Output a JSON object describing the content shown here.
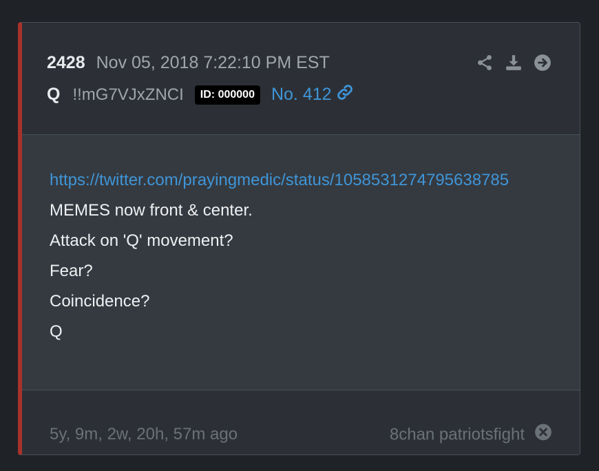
{
  "post": {
    "number": "2428",
    "date": "Nov 05, 2018 7:22:10 PM EST",
    "author": "Q",
    "tripcode": "!!mG7VJxZNCI",
    "id_badge": "ID: 000000",
    "post_no": "No. 412",
    "link": "https://twitter.com/prayingmedic/status/1058531274795638785",
    "lines": [
      "MEMES now front & center.",
      "Attack on 'Q' movement?",
      "Fear?",
      "Coincidence?",
      "Q"
    ],
    "time_ago": "5y, 9m, 2w, 20h, 57m ago",
    "source": "8chan patriotsfight"
  },
  "icons": {
    "share": "share-icon",
    "download": "download-icon",
    "next": "arrow-circle-right-icon",
    "link": "link-icon",
    "close": "close-circle-icon"
  },
  "colors": {
    "accent_border": "#a8332c",
    "link": "#3f95d8",
    "muted": "#6b7178"
  }
}
